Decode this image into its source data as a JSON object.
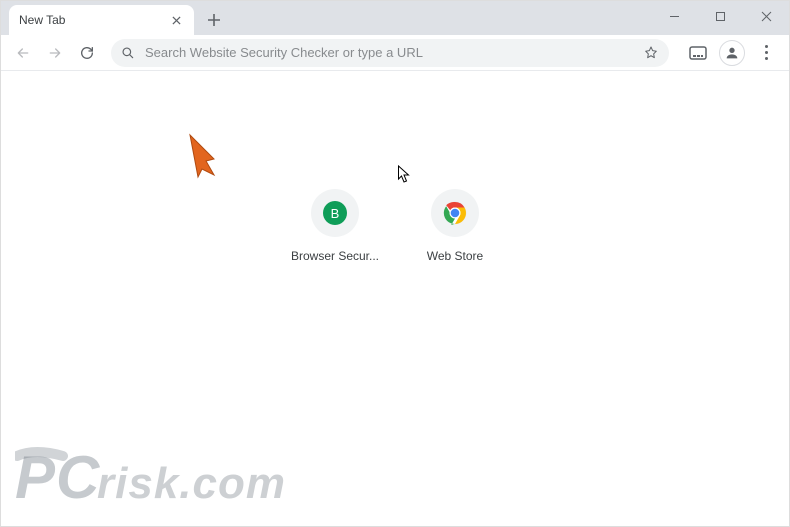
{
  "tab": {
    "title": "New Tab"
  },
  "omnibox": {
    "placeholder": "Search Website Security Checker or type a URL"
  },
  "shortcuts": [
    {
      "label": "Browser Secur...",
      "badge_letter": "B",
      "badge_bg": "#0f9d58"
    },
    {
      "label": "Web Store"
    }
  ],
  "watermark": {
    "text": "PCrisk.com"
  }
}
